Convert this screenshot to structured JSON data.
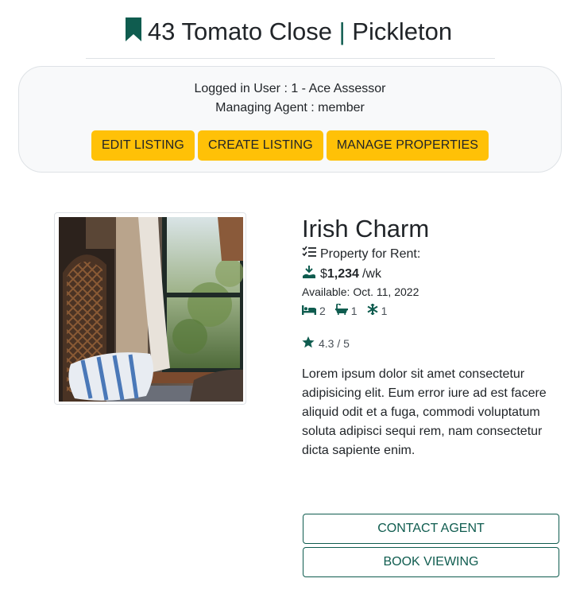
{
  "header": {
    "address": "43 Tomato Close",
    "separator": "|",
    "town": "Pickleton"
  },
  "session": {
    "logged_in": "Logged in User : 1 - Ace Assessor",
    "managing_agent": "Managing Agent : member"
  },
  "admin_buttons": {
    "edit": "EDIT LISTING",
    "create": "CREATE LISTING",
    "manage": "MANAGE PROPERTIES"
  },
  "listing": {
    "name": "Irish Charm",
    "type": "Property for Rent:",
    "currency": "$",
    "price": "1,234",
    "period": "/wk",
    "available": "Available: Oct. 11, 2022",
    "bedrooms": "2",
    "bathrooms": "1",
    "aircon": "1",
    "rating": "4.3 / 5",
    "description": "Lorem ipsum dolor sit amet consectetur adipisicing elit. Eum error iure ad est facere aliquid odit et a fuga, commodi voluptatum soluta adipisci sequi rem, nam consectetur dicta sapiente enim."
  },
  "actions": {
    "contact": "CONTACT AGENT",
    "book": "BOOK VIEWING"
  },
  "colors": {
    "accent": "#0f5c4f",
    "button_yellow": "#ffc107",
    "panel_bg": "#f8f9fa",
    "text": "#212529"
  },
  "icons": [
    "bookmark-icon",
    "checklist-icon",
    "hand-coin-icon",
    "bed-icon",
    "bath-icon",
    "snowflake-icon",
    "star-icon"
  ]
}
